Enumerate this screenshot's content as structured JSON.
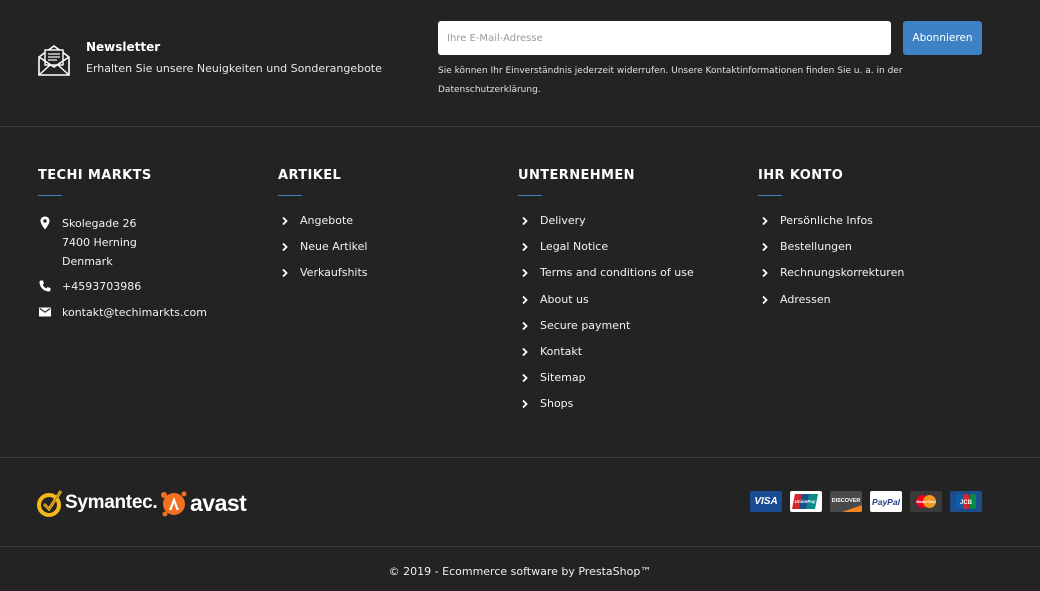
{
  "newsletter": {
    "icon": "envelope-open-icon",
    "title": "Newsletter",
    "subtitle": "Erhalten Sie unsere Neuigkeiten und Sonderangebote",
    "input_placeholder": "Ihre E-Mail-Adresse",
    "input_value": "",
    "subscribe_label": "Abonnieren",
    "note": "Sie können Ihr Einverständnis jederzeit widerrufen. Unsere Kontaktinformationen finden Sie u. a. in der Datenschutzerklärung.",
    "button_color": "#3d82c4"
  },
  "store": {
    "title": "TECHI MARKTS",
    "address_lines": [
      "Skolegade 26",
      "7400 Herning",
      "Denmark"
    ],
    "phone": "+4593703986",
    "email": "kontakt@techimarkts.com",
    "icons": [
      "map-pin-icon",
      "phone-icon",
      "mail-icon"
    ]
  },
  "articles": {
    "title": "ARTIKEL",
    "links": [
      "Angebote",
      "Neue Artikel",
      "Verkaufshits"
    ]
  },
  "company": {
    "title": "UNTERNEHMEN",
    "links": [
      "Delivery",
      "Legal Notice",
      "Terms and conditions of use",
      "About us",
      "Secure payment",
      "Kontakt",
      "Sitemap",
      "Shops"
    ]
  },
  "account": {
    "title": "IHR KONTO",
    "links": [
      "Persönliche Infos",
      "Bestellungen",
      "Rechnungskorrekturen",
      "Adressen"
    ]
  },
  "brands": {
    "symantec": "Symantec.",
    "avast": "avast",
    "payment_cards": [
      "VISA",
      "UnionPay",
      "DISCOVER",
      "PayPal",
      "MasterCard",
      "JCB"
    ]
  },
  "footer": {
    "copyright": "© 2019 - Ecommerce software by PrestaShop™"
  },
  "colors": {
    "background": "#232323",
    "accent": "#3d82c4",
    "divider": "#3a3a3a"
  }
}
